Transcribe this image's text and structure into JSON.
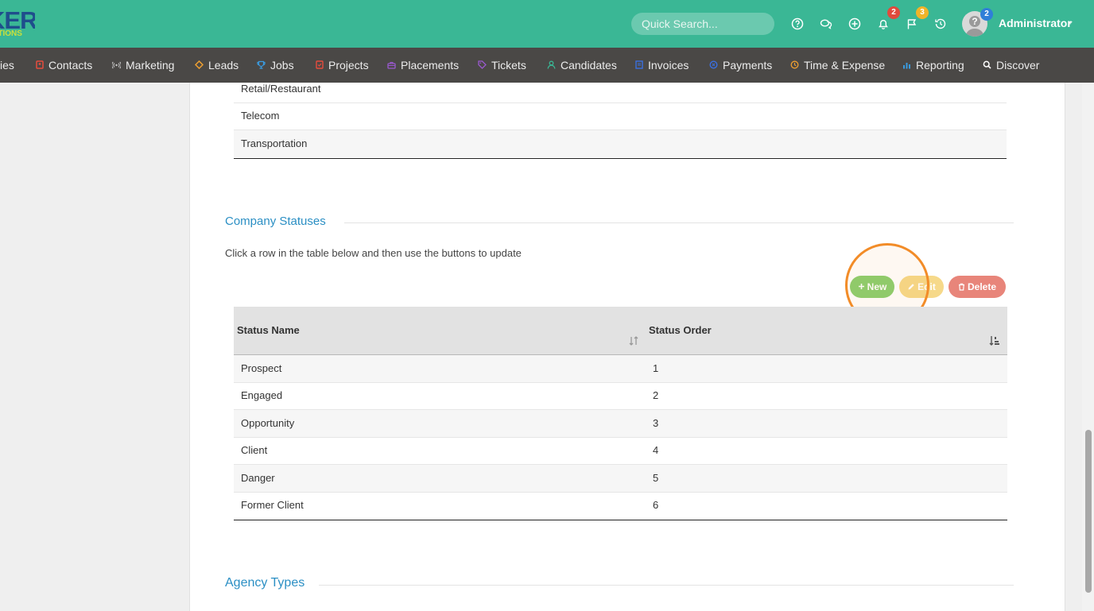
{
  "header": {
    "logo_line1": "KER",
    "logo_line2": "LUTIONS",
    "search_placeholder": "Quick Search...",
    "notifications_count": "2",
    "flags_count": "3",
    "avatar_badge": "2",
    "user_name": "Administrator"
  },
  "nav": {
    "items": [
      {
        "label": "ies",
        "icon": "companies-icon",
        "color": "#ffffff"
      },
      {
        "label": "Contacts",
        "icon": "contacts-icon",
        "color": "#e84c3d"
      },
      {
        "label": "Marketing",
        "icon": "broadcast-icon",
        "color": "#cccccc"
      },
      {
        "label": "Leads",
        "icon": "leads-icon",
        "color": "#f0a030"
      },
      {
        "label": "Jobs",
        "icon": "trophy-icon",
        "color": "#3a9be0"
      },
      {
        "label": "Projects",
        "icon": "projects-icon",
        "color": "#e84c3d"
      },
      {
        "label": "Placements",
        "icon": "briefcase-icon",
        "color": "#9b59d0"
      },
      {
        "label": "Tickets",
        "icon": "tag-icon",
        "color": "#9b59d0"
      },
      {
        "label": "Candidates",
        "icon": "user-icon",
        "color": "#3ab795"
      },
      {
        "label": "Invoices",
        "icon": "invoice-icon",
        "color": "#3a6fe0"
      },
      {
        "label": "Payments",
        "icon": "payments-icon",
        "color": "#3a6fe0"
      },
      {
        "label": "Time & Expense",
        "icon": "clock-icon",
        "color": "#f0a030"
      },
      {
        "label": "Reporting",
        "icon": "bar-chart-icon",
        "color": "#3a9be0"
      },
      {
        "label": "Discover",
        "icon": "search-icon",
        "color": "#ffffff"
      }
    ]
  },
  "industries": {
    "rows": [
      "Retail/Restaurant",
      "Telecom",
      "Transportation"
    ]
  },
  "company_statuses": {
    "title": "Company Statuses",
    "instruction": "Click a row in the table below and then use the buttons to update",
    "buttons": {
      "new": "New",
      "edit": "Edit",
      "delete": "Delete"
    },
    "columns": [
      "Status Name",
      "Status Order"
    ],
    "rows": [
      {
        "name": "Prospect",
        "order": "1"
      },
      {
        "name": "Engaged",
        "order": "2"
      },
      {
        "name": "Opportunity",
        "order": "3"
      },
      {
        "name": "Client",
        "order": "4"
      },
      {
        "name": "Danger",
        "order": "5"
      },
      {
        "name": "Former Client",
        "order": "6"
      }
    ]
  },
  "agency_types": {
    "title": "Agency Types"
  },
  "colors": {
    "header_bg": "#3ab795",
    "nav_bg": "#4a4846",
    "section_title": "#2b8fc4",
    "btn_new": "#8bcf6f",
    "btn_edit": "#f6d98a",
    "btn_delete": "#e8857a",
    "highlight": "#f28c28"
  }
}
